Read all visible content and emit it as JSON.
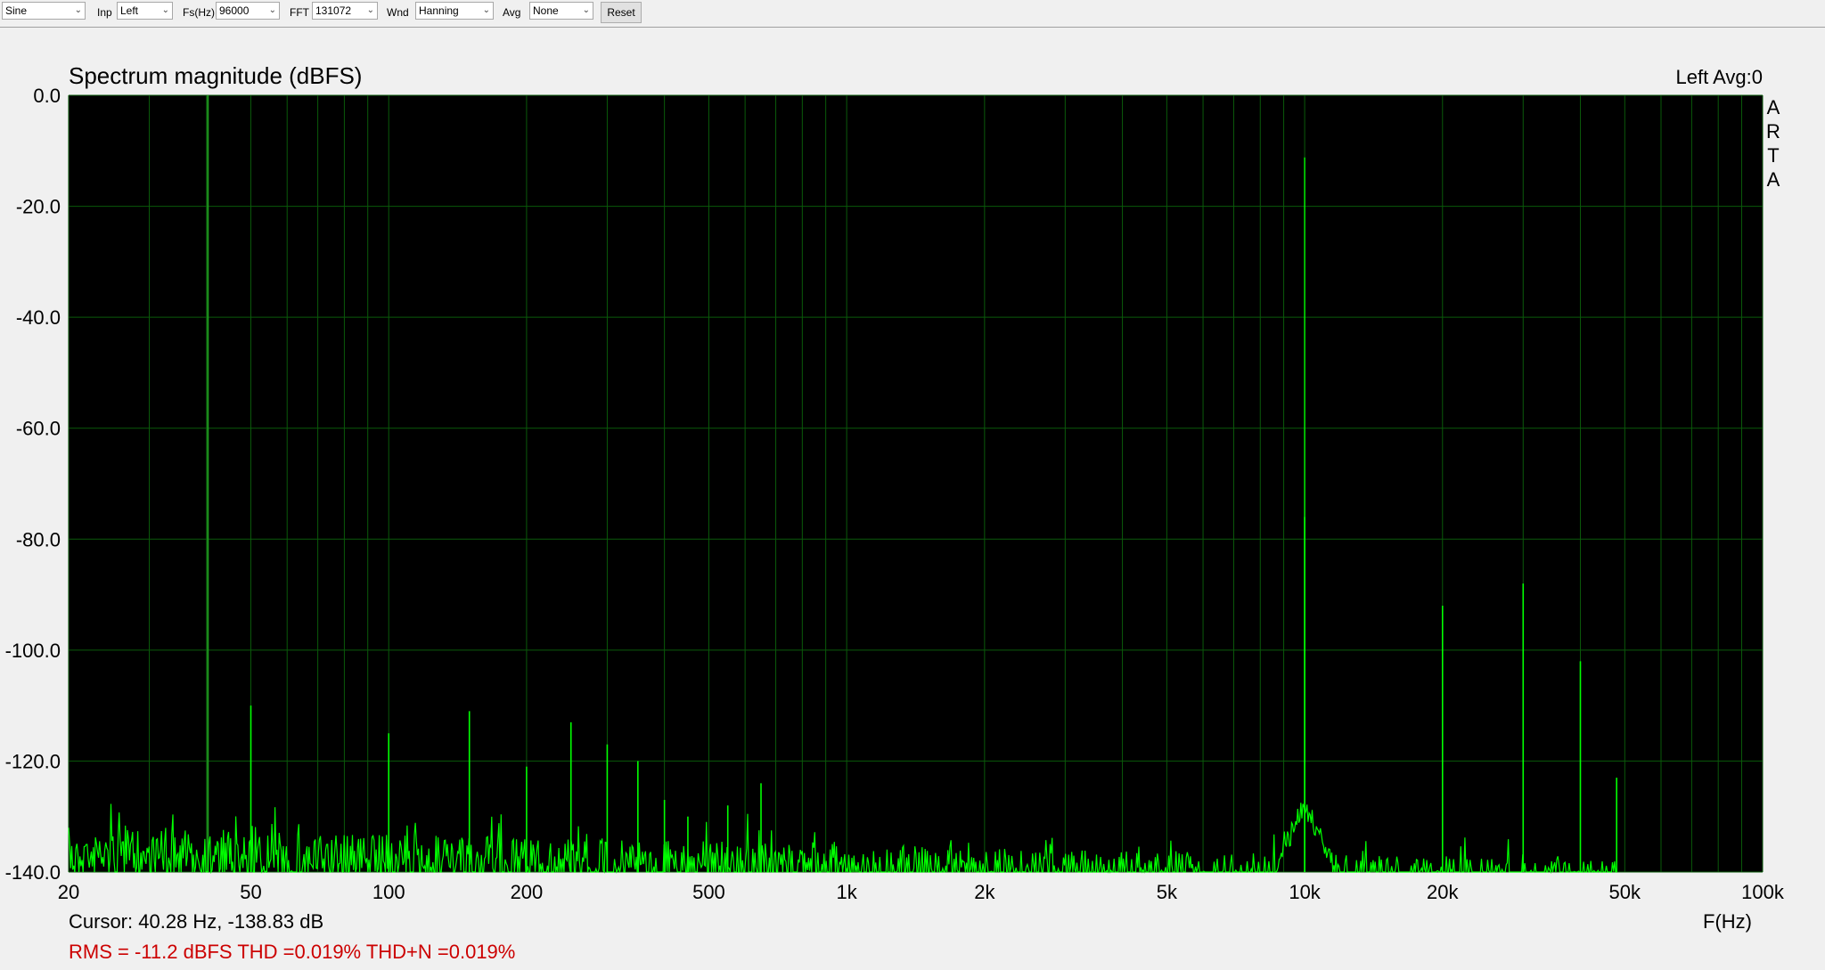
{
  "toolbar": {
    "signal": "Sine",
    "inp_label": "Inp",
    "inp_value": "Left",
    "fs_label": "Fs(Hz)",
    "fs_value": "96000",
    "fft_label": "FFT",
    "fft_value": "131072",
    "wnd_label": "Wnd",
    "wnd_value": "Hanning",
    "avg_label": "Avg",
    "avg_value": "None",
    "reset_label": "Reset"
  },
  "colors": {
    "plot_bg": "#000000",
    "trace": "#00ff00",
    "grid": "#0a5a0a",
    "cursor_line": "#1f9a1f",
    "status_text": "#cc0000",
    "window_bg": "#f0f0f0"
  },
  "chart_data": {
    "type": "line",
    "title": "Spectrum magnitude (dBFS)",
    "channel_info": "Left  Avg:0",
    "watermark": [
      "A",
      "R",
      "T",
      "A"
    ],
    "xlabel": "F(Hz)",
    "xscale": "log",
    "xlim": [
      20,
      100000
    ],
    "ylim": [
      -140,
      0
    ],
    "y_ticks": [
      "0.0",
      "-20.0",
      "-40.0",
      "-60.0",
      "-80.0",
      "-100.0",
      "-120.0",
      "-140.0"
    ],
    "y_tick_values": [
      0,
      -20,
      -40,
      -60,
      -80,
      -100,
      -120,
      -140
    ],
    "x_ticks": [
      "20",
      "50",
      "100",
      "200",
      "500",
      "1k",
      "2k",
      "5k",
      "10k",
      "20k",
      "50k",
      "100k"
    ],
    "x_tick_values": [
      20,
      50,
      100,
      200,
      500,
      1000,
      2000,
      5000,
      10000,
      20000,
      50000,
      100000
    ],
    "grid": true,
    "cursor_freq": 40.28,
    "fundamental": {
      "freq": 10000,
      "level": -11.2
    },
    "peaks": [
      {
        "freq": 10000,
        "level": -76
      },
      {
        "freq": 20000,
        "level": -92
      },
      {
        "freq": 30000,
        "level": -88
      },
      {
        "freq": 40000,
        "level": -102
      },
      {
        "freq": 48000,
        "level": -123
      },
      {
        "freq": 50,
        "level": -110
      },
      {
        "freq": 100,
        "level": -115
      },
      {
        "freq": 150,
        "level": -111
      },
      {
        "freq": 200,
        "level": -121
      },
      {
        "freq": 250,
        "level": -113
      },
      {
        "freq": 300,
        "level": -117
      },
      {
        "freq": 350,
        "level": -120
      },
      {
        "freq": 400,
        "level": -127
      },
      {
        "freq": 450,
        "level": -130
      },
      {
        "freq": 550,
        "level": -128
      },
      {
        "freq": 650,
        "level": -124
      }
    ],
    "noise_floor_low": -132,
    "noise_floor_high": -138
  },
  "status": {
    "cursor": "Cursor: 40.28 Hz, -138.83 dB",
    "metrics": "RMS =  -11.2 dBFS THD =0.019% THD+N =0.019%"
  }
}
